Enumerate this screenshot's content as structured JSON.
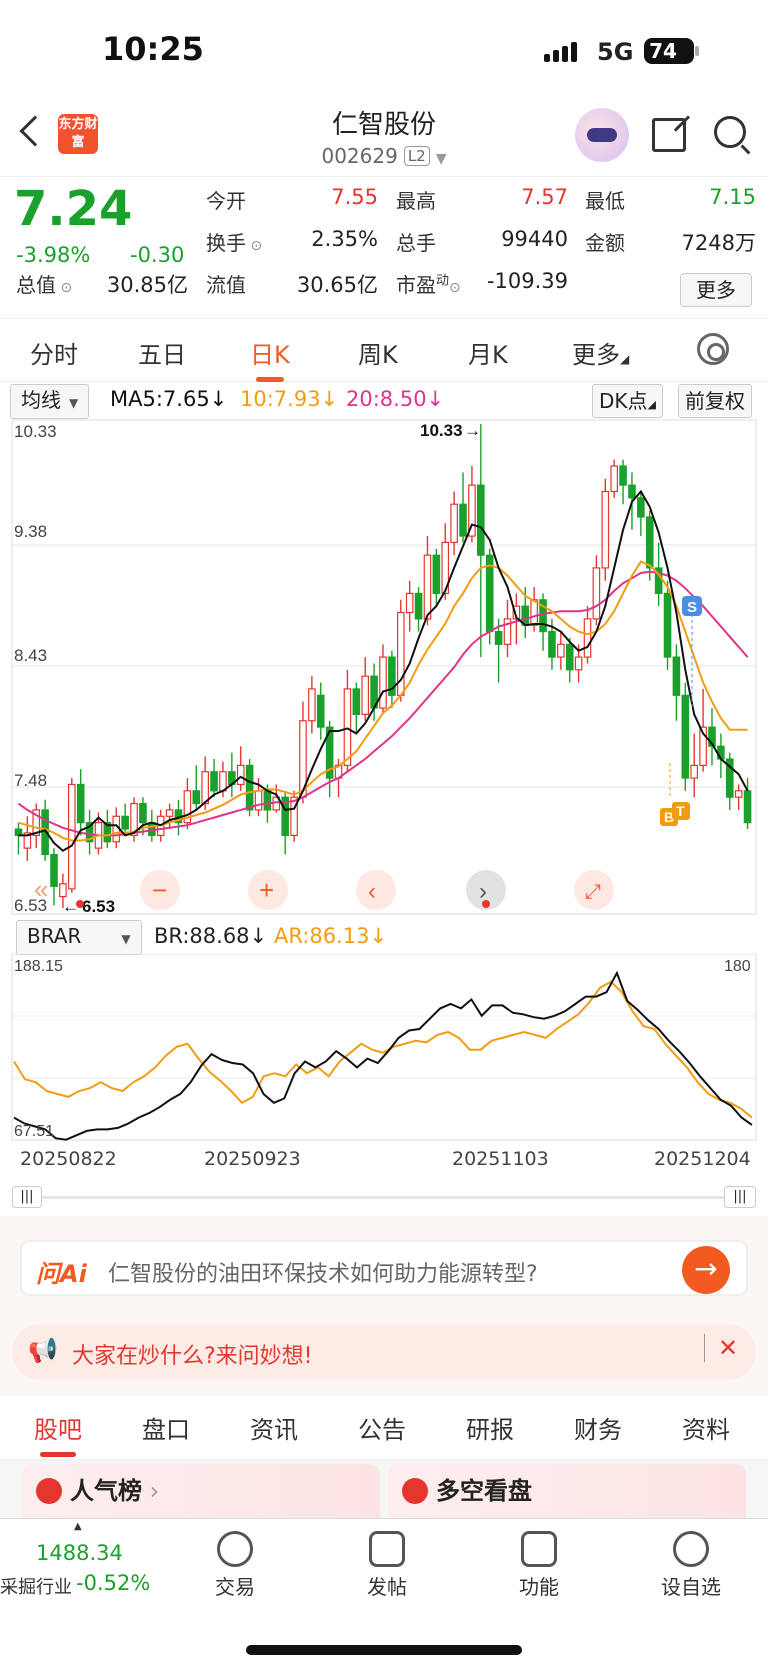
{
  "status": {
    "time": "10:25",
    "network": "5G",
    "battery": "74"
  },
  "header": {
    "logo_text": "东方财富",
    "title": "仁智股份",
    "code": "002629",
    "level": "L2"
  },
  "quote": {
    "price": "7.24",
    "change_pct": "-3.98%",
    "change_abs": "-0.30",
    "open_label": "今开",
    "open": "7.55",
    "high_label": "最高",
    "high": "7.57",
    "low_label": "最低",
    "low": "7.15",
    "turnover_label": "换手",
    "turnover": "2.35%",
    "volume_label": "总手",
    "volume": "99440",
    "amount_label": "金额",
    "amount": "7248万",
    "mktcap_label": "总值",
    "mktcap": "30.85亿",
    "float_label": "流值",
    "float": "30.65亿",
    "pe_label": "市盈",
    "pe_sup": "动",
    "pe": "-109.39",
    "more_label": "更多"
  },
  "ktabs": [
    "分时",
    "五日",
    "日K",
    "周K",
    "月K",
    "更多"
  ],
  "ktab_active": 2,
  "ma": {
    "selector": "均线",
    "ma5": "MA5:7.65↓",
    "ma10": "10:7.93↓",
    "ma20": "20:8.50↓",
    "dk": "DK点",
    "adjust": "前复权"
  },
  "kchart_axis": {
    "top": "10.33",
    "l2": "9.38",
    "l3": "8.43",
    "l4": "7.48",
    "bottom": "6.53",
    "max_label": "10.33",
    "min_label": "6.53"
  },
  "markers": {
    "sell": "S",
    "b": "B",
    "t": "T"
  },
  "indicator": {
    "selector": "BRAR",
    "br": "BR:88.68↓",
    "ar": "AR:86.13↓",
    "top": "188.15",
    "bottom": "67.51",
    "right": "180"
  },
  "dates": [
    "20250822",
    "20250923",
    "20251103",
    "20251204"
  ],
  "ask": {
    "brand": "问Ai",
    "text": "仁智股份的油田环保技术如何助力能源转型?"
  },
  "hot": {
    "text": "大家在炒什么?来问妙想!"
  },
  "bottom_tabs": [
    "股吧",
    "盘口",
    "资讯",
    "公告",
    "研报",
    "财务",
    "资料"
  ],
  "cards": [
    "人气榜",
    "多空看盘"
  ],
  "tabbar": {
    "index_value": "1488.34",
    "index_name": "采掘行业",
    "index_change": "-0.52%",
    "items": [
      "交易",
      "发帖",
      "功能",
      "设自选"
    ]
  },
  "colors": {
    "up": "#e4362f",
    "down": "#1ba12b",
    "accent": "#f25a22",
    "ma5": "#111111",
    "ma10": "#f39c12",
    "ma20": "#e0338a"
  },
  "chart_data": {
    "type": "candlestick",
    "ylim": [
      6.53,
      10.33
    ],
    "candles": [
      [
        7.15,
        7.1,
        7.2,
        6.95
      ],
      [
        7.0,
        7.12,
        7.25,
        6.9
      ],
      [
        7.1,
        7.3,
        7.35,
        7.0
      ],
      [
        7.3,
        6.95,
        7.38,
        6.9
      ],
      [
        6.95,
        6.7,
        7.0,
        6.55
      ],
      [
        6.62,
        6.72,
        6.8,
        6.53
      ],
      [
        6.68,
        7.5,
        7.55,
        6.65
      ],
      [
        7.5,
        7.2,
        7.62,
        7.1
      ],
      [
        7.2,
        7.05,
        7.3,
        6.95
      ],
      [
        7.0,
        7.2,
        7.28,
        6.95
      ],
      [
        7.2,
        7.05,
        7.3,
        7.0
      ],
      [
        7.05,
        7.25,
        7.32,
        7.0
      ],
      [
        7.25,
        7.15,
        7.35,
        7.1
      ],
      [
        7.1,
        7.35,
        7.4,
        7.05
      ],
      [
        7.35,
        7.2,
        7.4,
        7.1
      ],
      [
        7.2,
        7.1,
        7.3,
        7.05
      ],
      [
        7.1,
        7.25,
        7.3,
        7.05
      ],
      [
        7.25,
        7.3,
        7.35,
        7.15
      ],
      [
        7.3,
        7.2,
        7.38,
        7.1
      ],
      [
        7.2,
        7.45,
        7.55,
        7.15
      ],
      [
        7.45,
        7.35,
        7.65,
        7.3
      ],
      [
        7.35,
        7.6,
        7.72,
        7.3
      ],
      [
        7.6,
        7.45,
        7.7,
        7.4
      ],
      [
        7.45,
        7.6,
        7.68,
        7.4
      ],
      [
        7.6,
        7.5,
        7.75,
        7.4
      ],
      [
        7.5,
        7.65,
        7.8,
        7.45
      ],
      [
        7.65,
        7.3,
        7.7,
        7.25
      ],
      [
        7.3,
        7.45,
        7.55,
        7.25
      ],
      [
        7.45,
        7.3,
        7.5,
        7.2
      ],
      [
        7.3,
        7.4,
        7.5,
        7.28
      ],
      [
        7.4,
        7.1,
        7.45,
        6.95
      ],
      [
        7.1,
        7.4,
        7.45,
        7.05
      ],
      [
        7.4,
        8.0,
        8.15,
        7.35
      ],
      [
        8.0,
        8.25,
        8.35,
        7.9
      ],
      [
        8.2,
        7.95,
        8.3,
        7.85
      ],
      [
        7.95,
        7.55,
        8.0,
        7.4
      ],
      [
        7.55,
        7.65,
        7.7,
        7.4
      ],
      [
        7.65,
        8.25,
        8.4,
        7.6
      ],
      [
        8.25,
        8.05,
        8.3,
        7.9
      ],
      [
        8.05,
        8.35,
        8.5,
        8.0
      ],
      [
        8.35,
        8.1,
        8.45,
        8.0
      ],
      [
        8.1,
        8.5,
        8.6,
        8.05
      ],
      [
        8.5,
        8.2,
        8.55,
        8.1
      ],
      [
        8.2,
        8.85,
        8.95,
        8.15
      ],
      [
        8.85,
        9.0,
        9.1,
        8.7
      ],
      [
        9.0,
        8.8,
        9.05,
        8.7
      ],
      [
        8.8,
        9.3,
        9.45,
        8.75
      ],
      [
        9.3,
        9.0,
        9.35,
        8.9
      ],
      [
        9.0,
        9.4,
        9.55,
        8.95
      ],
      [
        9.4,
        9.7,
        9.8,
        9.3
      ],
      [
        9.7,
        9.45,
        9.95,
        9.4
      ],
      [
        9.45,
        9.85,
        10.0,
        9.4
      ],
      [
        9.85,
        9.3,
        10.33,
        8.5
      ],
      [
        9.3,
        8.7,
        9.35,
        8.6
      ],
      [
        8.7,
        8.6,
        8.8,
        8.3
      ],
      [
        8.6,
        8.8,
        8.95,
        8.5
      ],
      [
        8.8,
        8.9,
        9.0,
        8.6
      ],
      [
        8.9,
        8.75,
        9.05,
        8.65
      ],
      [
        8.75,
        8.95,
        9.05,
        8.7
      ],
      [
        8.95,
        8.7,
        9.0,
        8.55
      ],
      [
        8.7,
        8.5,
        8.8,
        8.4
      ],
      [
        8.5,
        8.6,
        8.7,
        8.4
      ],
      [
        8.6,
        8.4,
        8.65,
        8.3
      ],
      [
        8.4,
        8.5,
        8.6,
        8.3
      ],
      [
        8.5,
        8.8,
        8.9,
        8.45
      ],
      [
        8.8,
        9.2,
        9.3,
        8.75
      ],
      [
        9.2,
        9.8,
        9.9,
        9.1
      ],
      [
        9.8,
        10.0,
        10.05,
        9.75
      ],
      [
        10.0,
        9.85,
        10.05,
        9.7
      ],
      [
        9.85,
        9.75,
        9.95,
        9.5
      ],
      [
        9.75,
        9.6,
        9.8,
        9.45
      ],
      [
        9.6,
        9.2,
        9.65,
        9.1
      ],
      [
        9.2,
        9.0,
        9.4,
        8.9
      ],
      [
        9.0,
        8.5,
        9.1,
        8.4
      ],
      [
        8.5,
        8.2,
        8.6,
        8.0
      ],
      [
        8.2,
        7.55,
        8.3,
        7.45
      ],
      [
        7.55,
        7.65,
        7.9,
        7.4
      ],
      [
        7.65,
        7.95,
        8.25,
        7.6
      ],
      [
        7.95,
        7.8,
        8.1,
        7.65
      ],
      [
        7.8,
        7.7,
        7.9,
        7.55
      ],
      [
        7.7,
        7.4,
        7.75,
        7.3
      ],
      [
        7.4,
        7.45,
        7.5,
        7.3
      ],
      [
        7.45,
        7.2,
        7.55,
        7.15
      ]
    ],
    "ma5": [
      7.1,
      7.1,
      7.12,
      7.14,
      7.04,
      6.98,
      7.02,
      7.14,
      7.17,
      7.24,
      7.18,
      7.18,
      7.1,
      7.12,
      7.18,
      7.2,
      7.18,
      7.22,
      7.24,
      7.26,
      7.3,
      7.36,
      7.42,
      7.45,
      7.5,
      7.56,
      7.52,
      7.5,
      7.45,
      7.42,
      7.3,
      7.31,
      7.45,
      7.62,
      7.78,
      7.92,
      7.92,
      7.94,
      7.9,
      7.98,
      8.1,
      8.23,
      8.25,
      8.32,
      8.45,
      8.65,
      8.83,
      8.9,
      9.02,
      9.2,
      9.37,
      9.54,
      9.52,
      9.42,
      9.2,
      9.05,
      8.81,
      8.75,
      8.76,
      8.76,
      8.74,
      8.7,
      8.62,
      8.55,
      8.58,
      8.7,
      8.9,
      9.2,
      9.5,
      9.72,
      9.8,
      9.68,
      9.48,
      9.2,
      8.85,
      8.4,
      8.05,
      7.9,
      7.82,
      7.7,
      7.64,
      7.58,
      7.45
    ],
    "ma10": [
      7.2,
      7.18,
      7.16,
      7.15,
      7.12,
      7.08,
      7.06,
      7.06,
      7.07,
      7.1,
      7.1,
      7.12,
      7.12,
      7.13,
      7.16,
      7.17,
      7.18,
      7.2,
      7.22,
      7.24,
      7.26,
      7.28,
      7.31,
      7.34,
      7.38,
      7.42,
      7.44,
      7.45,
      7.46,
      7.46,
      7.44,
      7.42,
      7.45,
      7.52,
      7.58,
      7.62,
      7.64,
      7.7,
      7.76,
      7.86,
      7.96,
      8.06,
      8.12,
      8.2,
      8.3,
      8.44,
      8.56,
      8.66,
      8.76,
      8.9,
      9.0,
      9.12,
      9.2,
      9.22,
      9.2,
      9.14,
      9.06,
      8.98,
      8.94,
      8.9,
      8.86,
      8.8,
      8.74,
      8.7,
      8.68,
      8.7,
      8.76,
      8.86,
      9.0,
      9.14,
      9.25,
      9.22,
      9.15,
      9.05,
      8.9,
      8.7,
      8.5,
      8.3,
      8.15,
      8.02,
      7.93,
      7.93,
      7.93
    ],
    "ma20": [
      7.35,
      7.3,
      7.26,
      7.22,
      7.19,
      7.16,
      7.14,
      7.12,
      7.11,
      7.1,
      7.1,
      7.1,
      7.11,
      7.12,
      7.13,
      7.14,
      7.15,
      7.16,
      7.17,
      7.18,
      7.2,
      7.22,
      7.24,
      7.26,
      7.28,
      7.3,
      7.32,
      7.34,
      7.35,
      7.36,
      7.36,
      7.37,
      7.4,
      7.44,
      7.48,
      7.52,
      7.55,
      7.6,
      7.65,
      7.7,
      7.76,
      7.82,
      7.88,
      7.95,
      8.02,
      8.1,
      8.18,
      8.26,
      8.34,
      8.42,
      8.52,
      8.6,
      8.66,
      8.7,
      8.74,
      8.76,
      8.78,
      8.8,
      8.82,
      8.84,
      8.85,
      8.86,
      8.86,
      8.86,
      8.87,
      8.9,
      8.95,
      9.02,
      9.08,
      9.12,
      9.16,
      9.17,
      9.16,
      9.14,
      9.1,
      9.04,
      8.97,
      8.9,
      8.82,
      8.74,
      8.66,
      8.58,
      8.5
    ],
    "br": [
      80,
      76,
      74,
      72,
      66,
      65,
      68,
      71,
      72,
      72,
      73,
      76,
      80,
      83,
      87,
      92,
      96,
      104,
      115,
      123,
      119,
      117,
      116,
      110,
      96,
      90,
      93,
      110,
      118,
      114,
      118,
      125,
      120,
      114,
      120,
      117,
      125,
      134,
      139,
      140,
      147,
      154,
      157,
      154,
      160,
      149,
      156,
      156,
      151,
      150,
      148,
      147,
      149,
      152,
      157,
      162,
      162,
      165,
      178,
      159,
      153,
      146,
      140,
      132,
      125,
      117,
      108,
      100,
      92,
      88,
      80,
      75
    ],
    "ar": [
      118,
      106,
      104,
      98,
      96,
      94,
      98,
      100,
      104,
      100,
      98,
      104,
      108,
      114,
      122,
      128,
      130,
      120,
      111,
      105,
      98,
      90,
      94,
      108,
      110,
      108,
      116,
      110,
      114,
      108,
      118,
      124,
      130,
      126,
      124,
      128,
      130,
      132,
      131,
      136,
      138,
      134,
      126,
      126,
      132,
      134,
      136,
      138,
      136,
      134,
      140,
      145,
      150,
      158,
      168,
      172,
      165,
      152,
      142,
      140,
      130,
      122,
      114,
      104,
      96,
      92,
      90,
      86,
      80
    ]
  }
}
